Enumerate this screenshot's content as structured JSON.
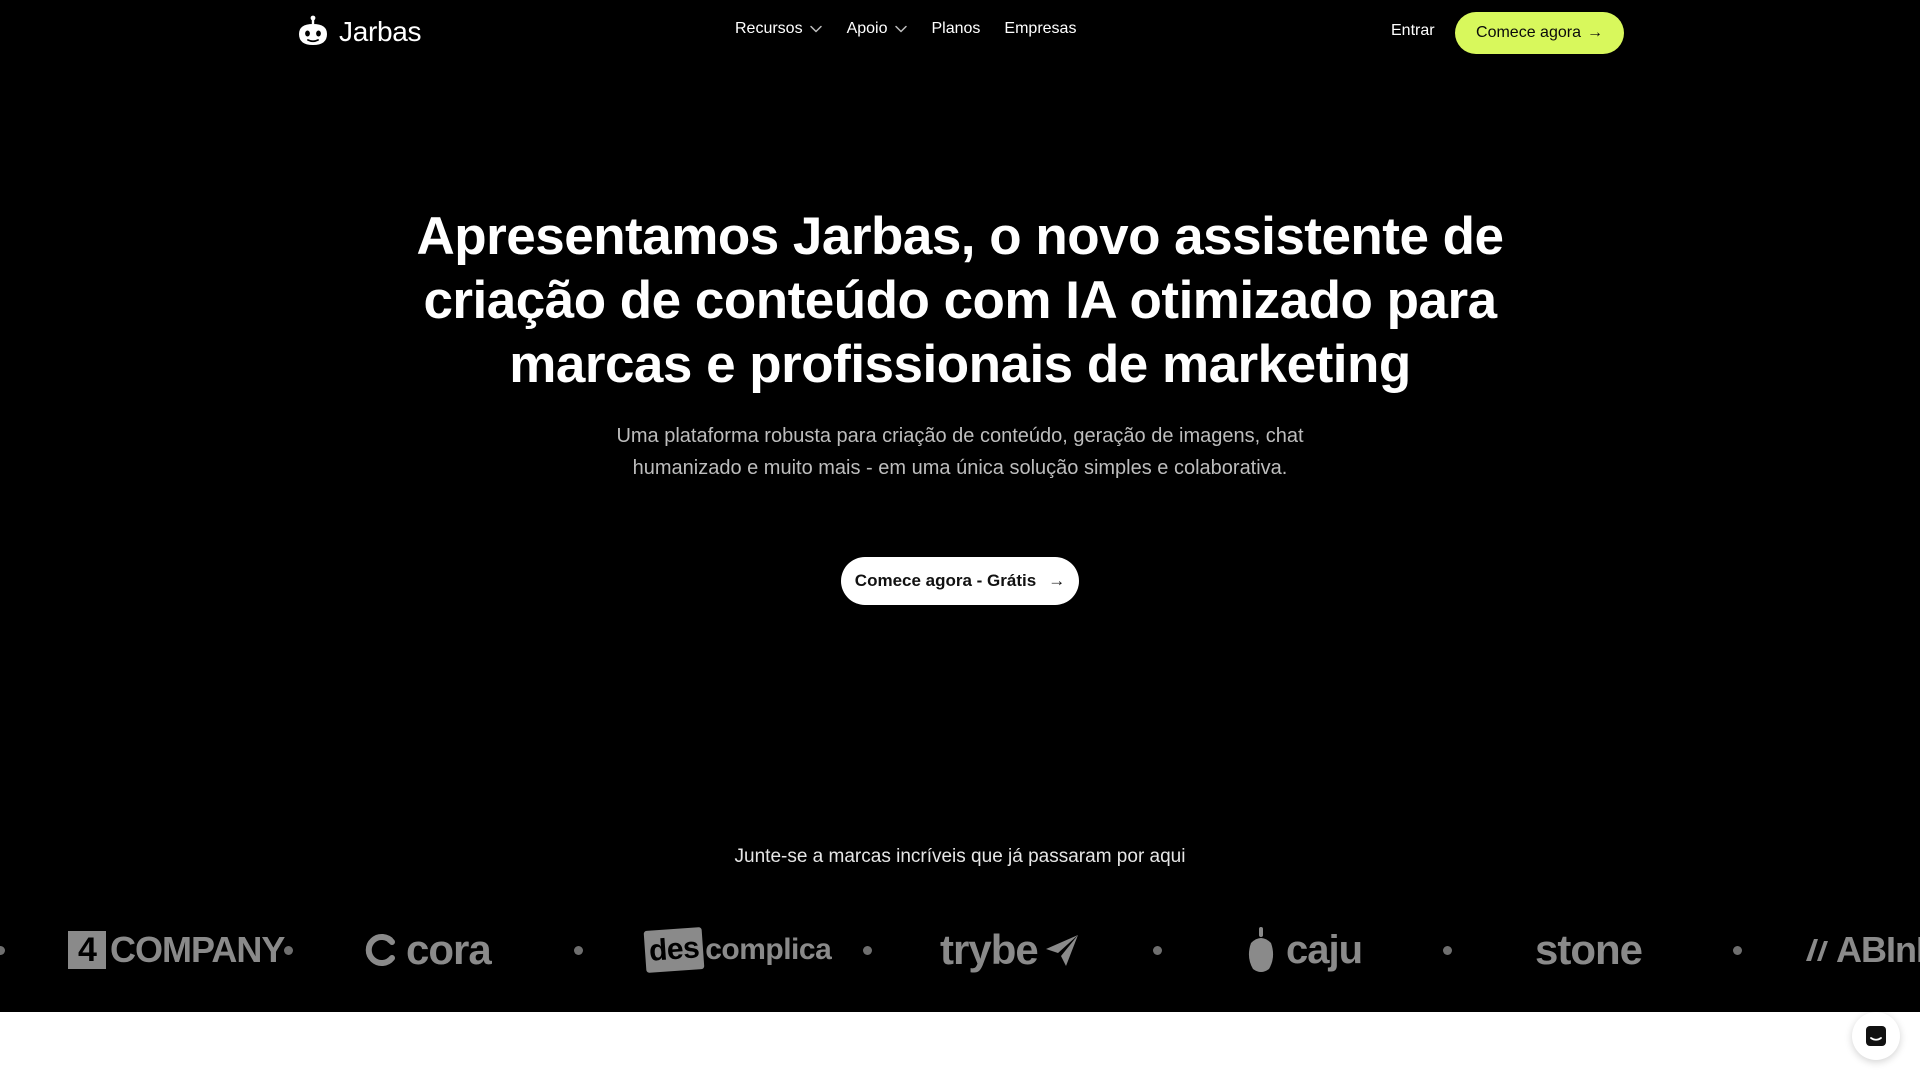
{
  "header": {
    "logo_text": "Jarbas",
    "nav": [
      {
        "label": "Recursos",
        "has_dropdown": true
      },
      {
        "label": "Apoio",
        "has_dropdown": true
      },
      {
        "label": "Planos",
        "has_dropdown": false
      },
      {
        "label": "Empresas",
        "has_dropdown": false
      }
    ],
    "login_label": "Entrar",
    "cta_label": "Comece agora",
    "cta_arrow": "→"
  },
  "hero": {
    "title": "Apresentamos Jarbas, o novo assistente de criação de conteúdo com IA otimizado para marcas e profissionais de marketing",
    "subtitle": "Uma plataforma robusta para criação de conteúdo, geração de imagens, chat humanizado e muito mais - em uma única solução simples e colaborativa.",
    "cta_label": "Comece agora - Grátis",
    "cta_arrow": "→"
  },
  "brands": {
    "caption": "Junte-se a marcas incríveis que já passaram por aqui",
    "logos": {
      "company_4_digit": "4",
      "company_4_text": "COMPANY",
      "cora": "cora",
      "descomplica_a": "des",
      "descomplica_b": "complica",
      "trybe": "trybe",
      "caju": "caju",
      "stone": "stone",
      "abinbev": "ABInB"
    }
  },
  "colors": {
    "background": "#000000",
    "accent": "#d8f85c",
    "logo_gray": "#8a8a8a"
  },
  "icons": {
    "logo": "robot-icon",
    "dropdown": "chevron-down-icon",
    "chat": "chat-bubble-icon"
  }
}
